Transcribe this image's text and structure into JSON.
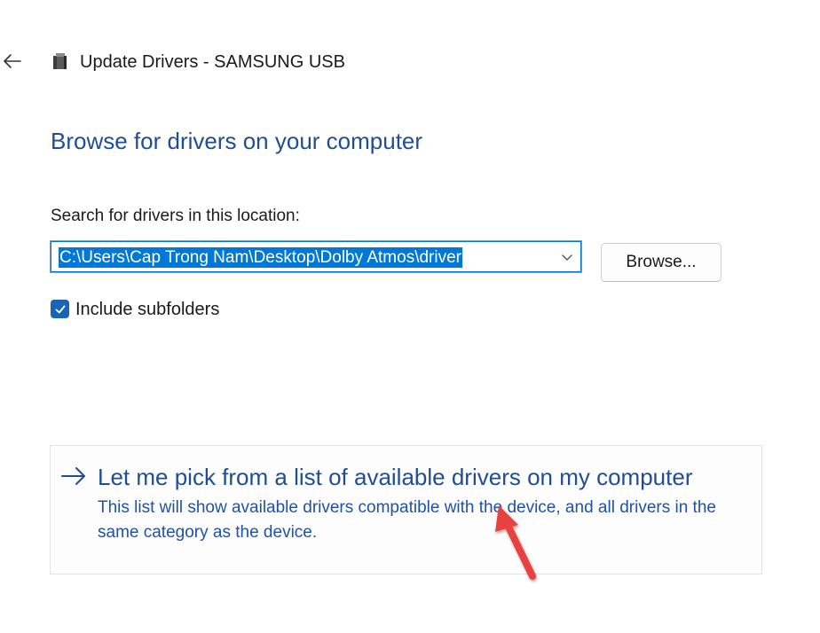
{
  "header": {
    "title": "Update Drivers - SAMSUNG USB",
    "back_icon": "back-arrow-icon",
    "device_icon": "usb-device-icon"
  },
  "main": {
    "heading": "Browse for drivers on your computer",
    "search_label": "Search for drivers in this location:",
    "path_value": "C:\\Users\\Cap Trong Nam\\Desktop\\Dolby Atmos\\driver",
    "browse_label": "Browse...",
    "include_subfolders_label": "Include subfolders",
    "include_subfolders_checked": true
  },
  "pick_option": {
    "title": "Let me pick from a list of available drivers on my computer",
    "description": "This list will show available drivers compatible with the device, and all drivers in the same category as the device.",
    "icon": "arrow-right-icon"
  },
  "colors": {
    "heading_blue": "#1f4e96",
    "selection_blue": "#0078d7",
    "checkbox_blue": "#1a64b4",
    "annotation_red": "#e8423f"
  }
}
